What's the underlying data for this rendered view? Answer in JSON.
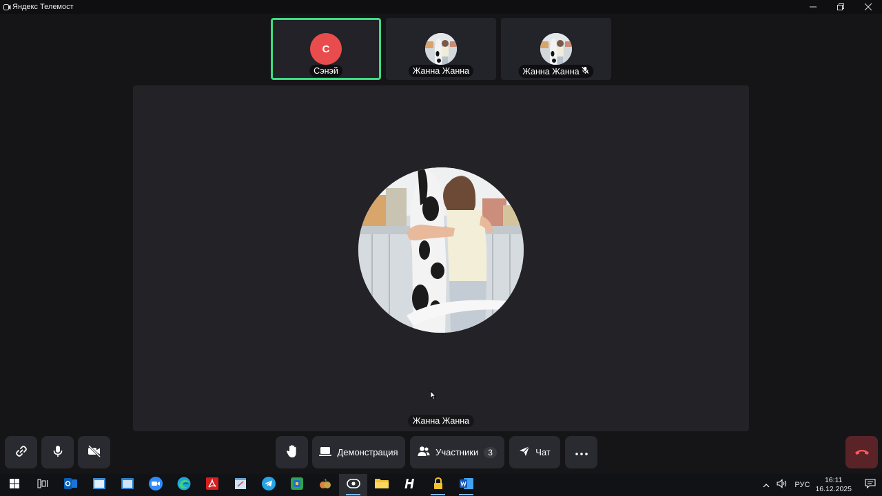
{
  "window": {
    "title": "Яндекс Телемост"
  },
  "participants": [
    {
      "name": "Сэнэй",
      "initial": "С",
      "avatar_color": "#e84c4c",
      "speaking": true,
      "muted": false
    },
    {
      "name": "Жанна Жанна",
      "muted": false
    },
    {
      "name": "Жанна Жанна",
      "muted": true
    }
  ],
  "stage": {
    "name": "Жанна Жанна"
  },
  "controls": {
    "demo_label": "Демонстрация",
    "participants_label": "Участники",
    "participants_count": "3",
    "chat_label": "Чат"
  },
  "taskbar": {
    "language": "РУС",
    "time": "16:11",
    "date": "16.12.2025"
  },
  "colors": {
    "accent_green": "#3ddc84",
    "hangup": "#5a2328",
    "background": "#151518"
  }
}
